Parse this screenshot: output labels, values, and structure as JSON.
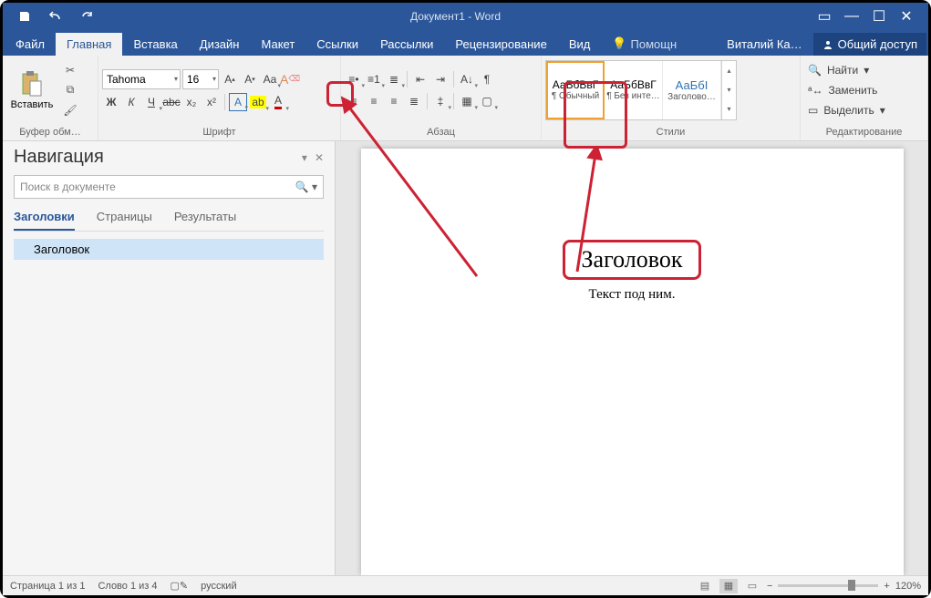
{
  "qat": {
    "title": "Документ1 - Word"
  },
  "tabs": {
    "file": "Файл",
    "home": "Главная",
    "insert": "Вставка",
    "design": "Дизайн",
    "layout": "Макет",
    "references": "Ссылки",
    "mailings": "Рассылки",
    "review": "Рецензирование",
    "view": "Вид",
    "tell": "Помощн",
    "user": "Виталий Ка…",
    "share": "Общий доступ"
  },
  "ribbon": {
    "clipboard": {
      "title": "Буфер обм…",
      "paste": "Вставить"
    },
    "font": {
      "title": "Шрифт",
      "name": "Tahoma",
      "size": "16",
      "bold": "Ж",
      "italic": "К",
      "underline": "Ч",
      "strike": "abc",
      "sub": "x₂",
      "sup": "x²"
    },
    "paragraph": {
      "title": "Абзац"
    },
    "styles": {
      "title": "Стили",
      "items": [
        {
          "preview": "АаБбВвГ",
          "label": "¶ Обычный"
        },
        {
          "preview": "АаБбВвГ",
          "label": "¶ Без инте…"
        },
        {
          "preview": "АаБбІ",
          "label": "Заголово…"
        }
      ]
    },
    "editing": {
      "title": "Редактирование",
      "find": "Найти",
      "replace": "Заменить",
      "select": "Выделить"
    }
  },
  "nav": {
    "title": "Навигация",
    "search_placeholder": "Поиск в документе",
    "tabs": {
      "headings": "Заголовки",
      "pages": "Страницы",
      "results": "Результаты"
    },
    "tree_item": "Заголовок"
  },
  "document": {
    "heading": "Заголовок",
    "body": "Текст под ним."
  },
  "status": {
    "page": "Страница 1 из 1",
    "words": "Слово 1 из 4",
    "lang": "русский",
    "zoom": "120%"
  }
}
